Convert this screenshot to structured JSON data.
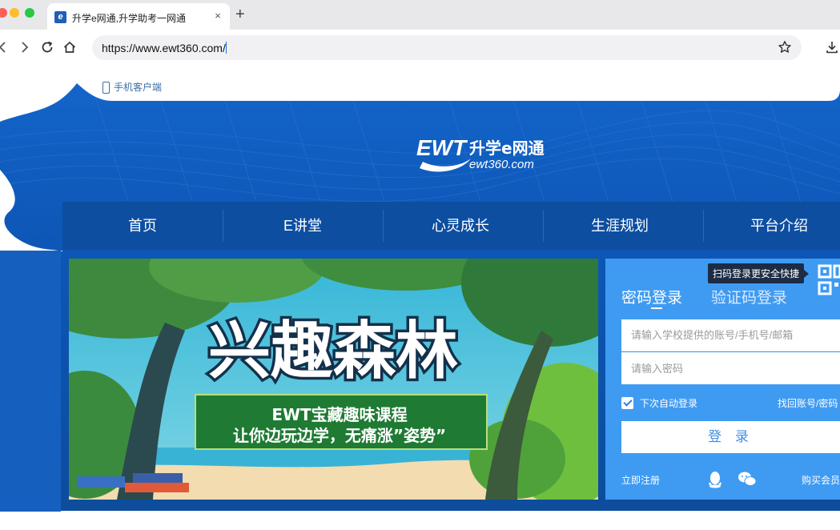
{
  "browser": {
    "tab_title": "升学e网通,升学助考一网通",
    "tab_favicon": "e",
    "close_glyph": "×",
    "newtab_glyph": "+",
    "url": "https://www.ewt360.com/"
  },
  "site": {
    "mobile_link": "手机客户端",
    "logo": {
      "mark": "EWT",
      "name": "升学e网通",
      "domain": "ewt360.com"
    },
    "nav": [
      "首页",
      "E讲堂",
      "心灵成长",
      "生涯规划",
      "平台介绍"
    ],
    "banner": {
      "title": "兴趣森林",
      "line1": "EWT宝藏趣味课程",
      "line2": "让你边玩边学，无痛涨”姿势”"
    },
    "login": {
      "qr_tip": "扫码登录更安全快捷",
      "tab_password": "密码登录",
      "tab_sms": "验证码登录",
      "account_placeholder": "请输入学校提供的账号/手机号/邮箱",
      "password_placeholder": "请输入密码",
      "remember_label": "下次自动登录",
      "forgot_link": "找回账号/密码",
      "login_button": "登 录",
      "register_link": "立即注册",
      "buy_link": "购买会员"
    }
  },
  "colors": {
    "brand_blue": "#0d4ea1",
    "login_panel": "#3f9bf2",
    "tip_bg": "#1d2c45"
  },
  "icons": [
    "back-icon",
    "forward-icon",
    "reload-icon",
    "home-icon",
    "bookmark-star-icon",
    "download-icon",
    "phone-icon",
    "qr-code-icon",
    "qq-icon",
    "wechat-icon"
  ]
}
